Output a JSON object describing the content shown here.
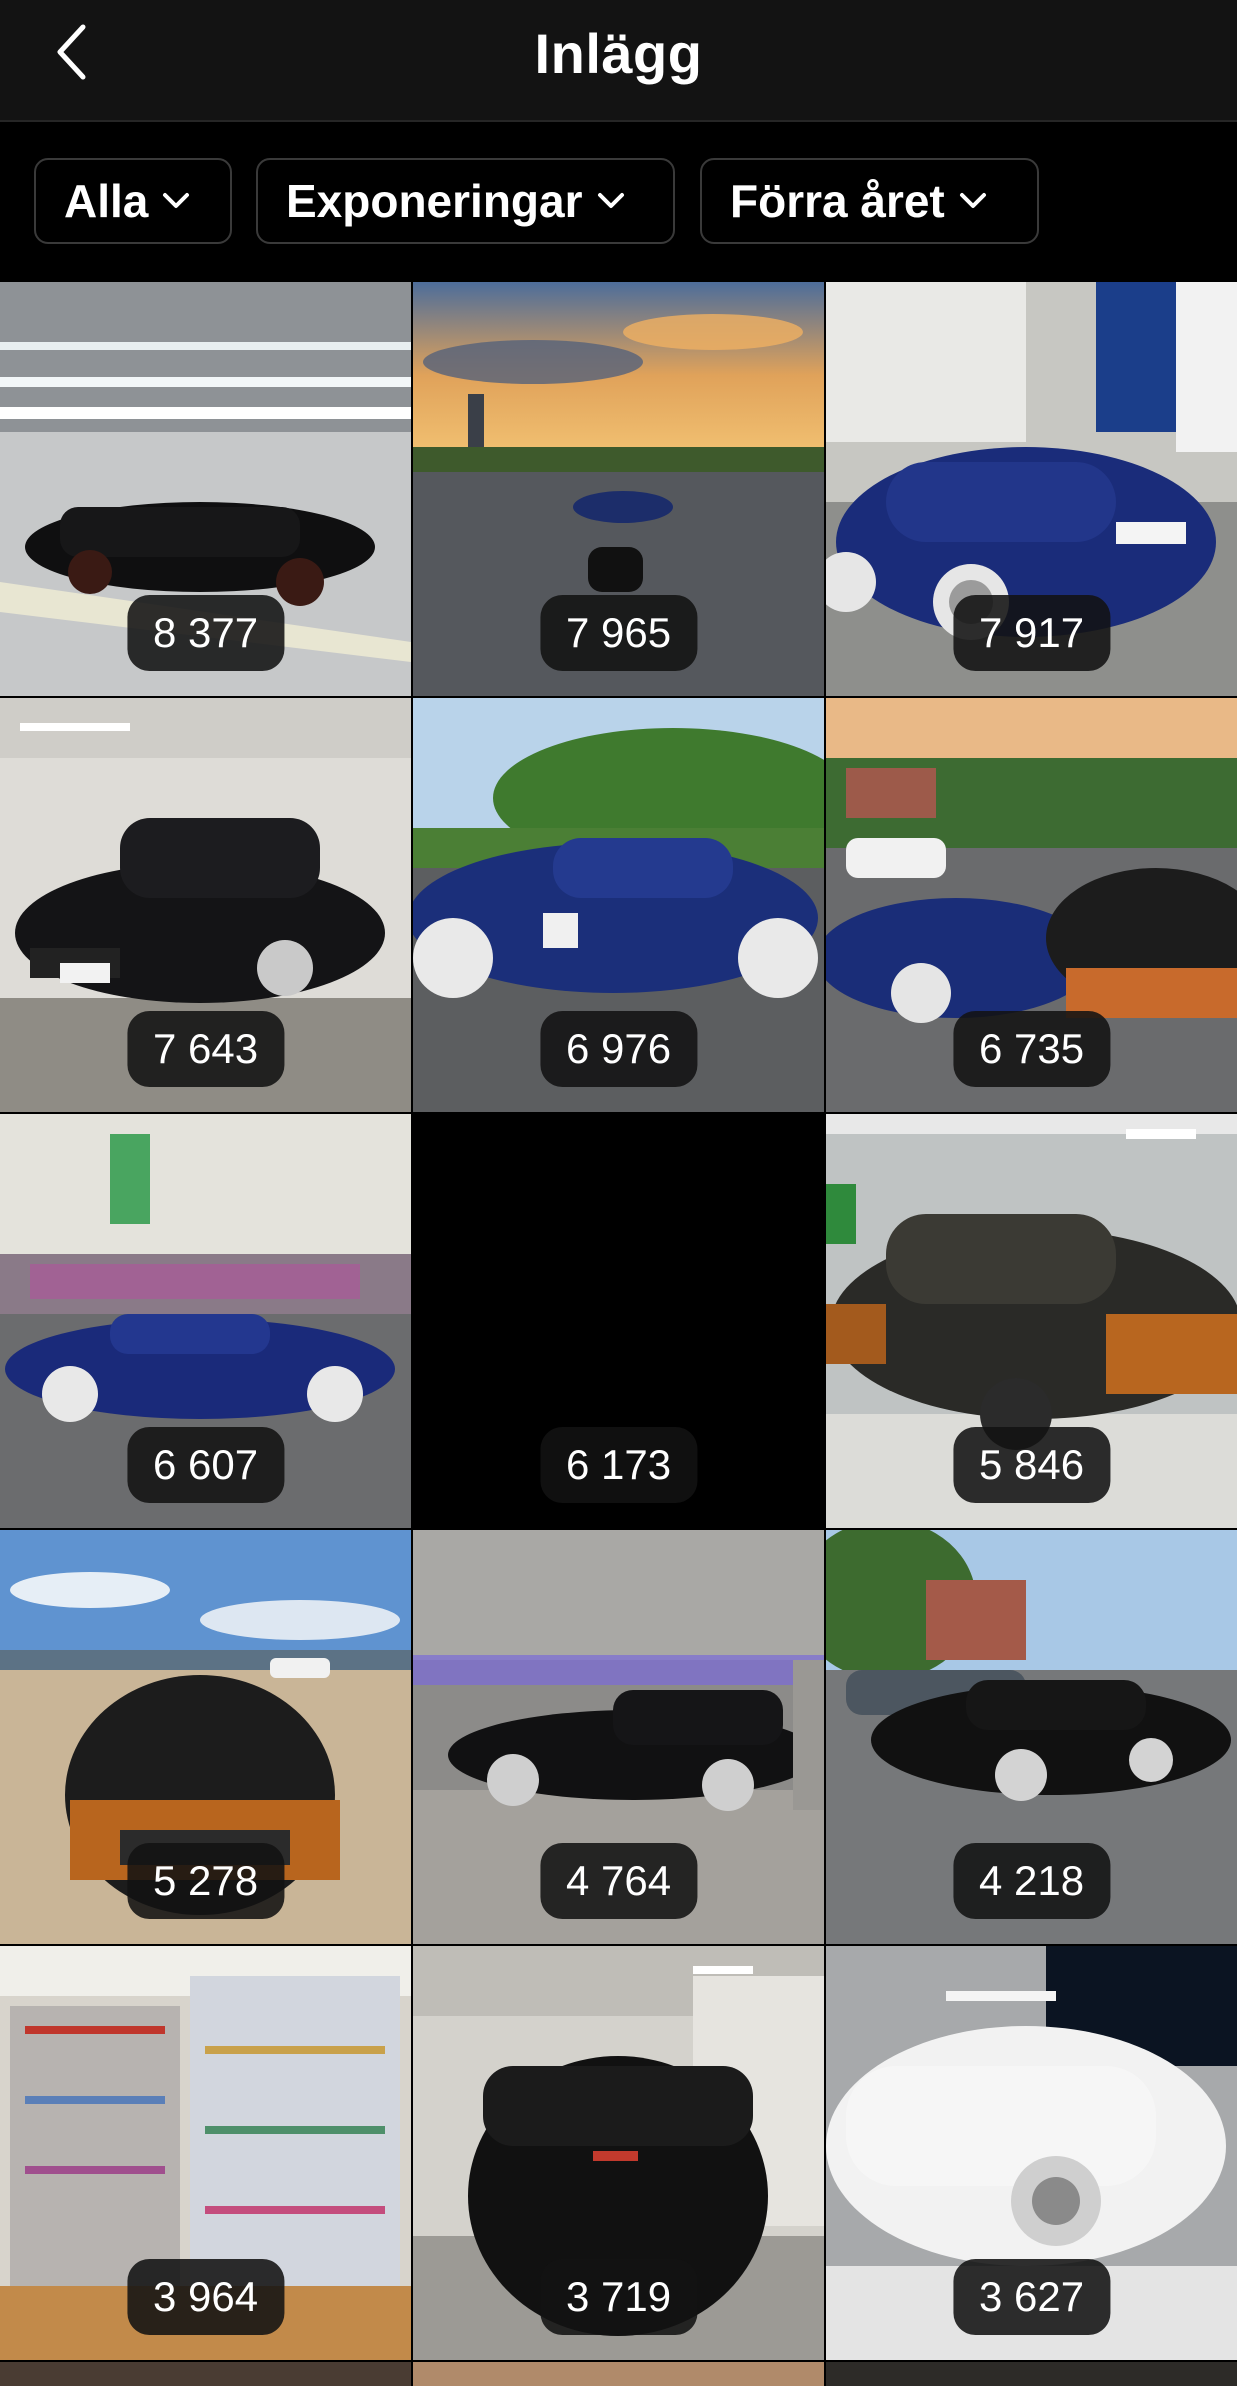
{
  "header": {
    "title": "Inlägg",
    "back_icon": "chevron-left-icon"
  },
  "filters": [
    {
      "label": "Alla",
      "icon": "chevron-down-icon"
    },
    {
      "label": "Exponeringar",
      "icon": "chevron-down-icon"
    },
    {
      "label": "Förra året",
      "icon": "chevron-down-icon"
    }
  ],
  "posts": [
    {
      "count": "8 377",
      "scene": "black sports car in parking garage"
    },
    {
      "count": "7 965",
      "scene": "blue coupe at sunset with photographer"
    },
    {
      "count": "7 917",
      "scene": "blue coupe outside garage"
    },
    {
      "count": "7 643",
      "scene": "black convertible in garage"
    },
    {
      "count": "6 976",
      "scene": "blue coupe side view in park"
    },
    {
      "count": "6 735",
      "scene": "blue coupe and orange coupe"
    },
    {
      "count": "6 607",
      "scene": "blue coupe by graffiti wall"
    },
    {
      "count": "6 173",
      "scene": "black frame"
    },
    {
      "count": "5 846",
      "scene": "orange black coupe in wash"
    },
    {
      "count": "5 278",
      "scene": "orange black coupe on beach"
    },
    {
      "count": "4 764",
      "scene": "black convertible in garage"
    },
    {
      "count": "4 218",
      "scene": "black convertible in parking lot"
    },
    {
      "count": "3 964",
      "scene": "sneaker box shelves"
    },
    {
      "count": "3 719",
      "scene": "black sports car front"
    },
    {
      "count": "3 627",
      "scene": "foam covered car"
    }
  ]
}
